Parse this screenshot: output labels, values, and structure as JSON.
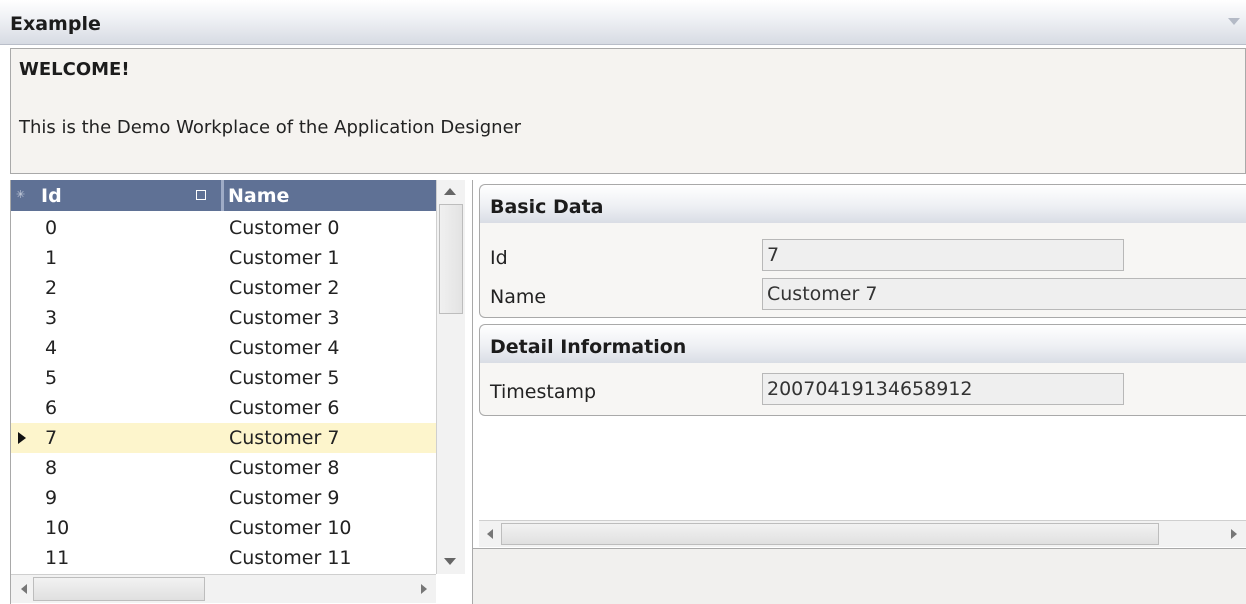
{
  "window": {
    "title": "Example"
  },
  "welcome": {
    "heading": "WELCOME!",
    "message": "This is the Demo Workplace of the Application Designer"
  },
  "grid": {
    "columns": [
      "Id",
      "Name"
    ],
    "selected_index": 7,
    "rows": [
      {
        "id": "0",
        "name": "Customer 0"
      },
      {
        "id": "1",
        "name": "Customer 1"
      },
      {
        "id": "2",
        "name": "Customer 2"
      },
      {
        "id": "3",
        "name": "Customer 3"
      },
      {
        "id": "4",
        "name": "Customer 4"
      },
      {
        "id": "5",
        "name": "Customer 5"
      },
      {
        "id": "6",
        "name": "Customer 6"
      },
      {
        "id": "7",
        "name": "Customer 7"
      },
      {
        "id": "8",
        "name": "Customer 8"
      },
      {
        "id": "9",
        "name": "Customer 9"
      },
      {
        "id": "10",
        "name": "Customer 10"
      },
      {
        "id": "11",
        "name": "Customer 11"
      }
    ]
  },
  "basic_data": {
    "title": "Basic Data",
    "id_label": "Id",
    "id_value": "7",
    "name_label": "Name",
    "name_value": "Customer 7"
  },
  "detail_info": {
    "title": "Detail Information",
    "timestamp_label": "Timestamp",
    "timestamp_value": "20070419134658912"
  },
  "colors": {
    "grid_header": "#5f7195",
    "selected_row": "#fdf5cc",
    "welcome_bg": "#f5f3f0"
  },
  "icons": [
    "collapse-icon",
    "row-marker-icon",
    "sort-icon",
    "scroll-up-icon",
    "scroll-down-icon",
    "scroll-left-icon",
    "scroll-right-icon"
  ]
}
